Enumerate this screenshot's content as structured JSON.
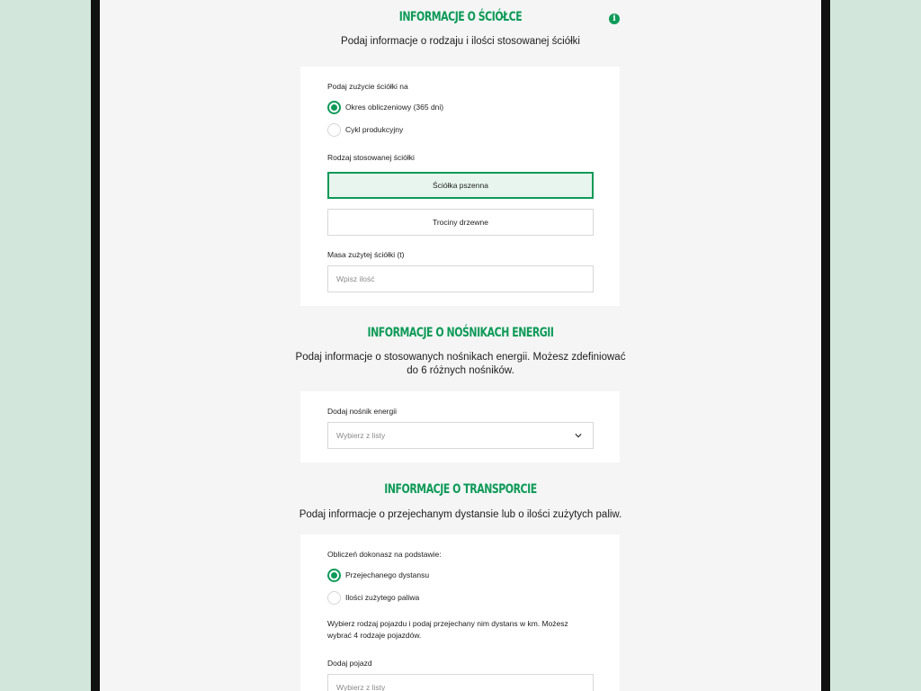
{
  "colors": {
    "accent": "#0d9a58",
    "page_bg": "#d2e6dc",
    "screen_bg": "#f5f5f5",
    "selected_bg": "#e8f5ee"
  },
  "litter": {
    "title": "INFORMACJE O ŚCIÓŁCE",
    "subtitle": "Podaj informacje o rodzaju i ilości stosowanej ściółki",
    "info_icon": "info-icon",
    "usage_label": "Podaj zużycie ściółki na",
    "usage_options": [
      {
        "label": "Okres obliczeniowy (365 dni)",
        "checked": true
      },
      {
        "label": "Cykl produkcyjny",
        "checked": false
      }
    ],
    "type_label": "Rodzaj stosowanej ściółki",
    "type_options": [
      {
        "label": "Ściółka pszenna",
        "selected": true
      },
      {
        "label": "Trociny drzewne",
        "selected": false
      }
    ],
    "mass_label": "Masa zużytej ściółki (t)",
    "mass_placeholder": "Wpisz ilość"
  },
  "energy": {
    "title": "INFORMACJE O NOŚNIKACH ENERGII",
    "subtitle_line1": "Podaj informacje o stosowanych nośnikach energii. Możesz zdefiniować",
    "subtitle_line2": "do 6 różnych nośników.",
    "add_label": "Dodaj nośnik energii",
    "select_placeholder": "Wybierz z listy",
    "chevron_icon": "chevron-down-icon"
  },
  "transport": {
    "title": "INFORMACJE O TRANSPORCIE",
    "subtitle": "Podaj informacje o przejechanym dystansie lub o ilości zużytych paliw.",
    "basis_label": "Obliczeń dokonasz na podstawie:",
    "basis_options": [
      {
        "label": "Przejechanego dystansu",
        "checked": true
      },
      {
        "label": "Ilości zużytego paliwa",
        "checked": false
      }
    ],
    "helper_text": "Wybierz rodzaj pojazdu i podaj przejechany nim dystans w km. Możesz wybrać 4 rodzaje pojazdów.",
    "vehicle_label": "Dodaj pojazd",
    "vehicle_placeholder": "Wybierz z listy"
  }
}
